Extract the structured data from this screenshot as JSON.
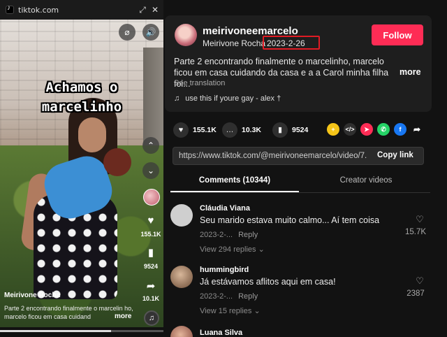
{
  "window": {
    "site": "tiktok.com"
  },
  "video": {
    "caption_line1": "Achamos o",
    "caption_line2": "marcelinho",
    "author": "Meirivone Rocha",
    "description": "Parte 2 encontrando finalmente o marcelin ho, marcelo ficou em casa cuidand",
    "more_label": "more",
    "likes": "155.1K",
    "saves": "9524",
    "shares": "10.1K",
    "progress": 0.68
  },
  "post": {
    "username": "meirivoneemarcelo",
    "nickname": "Meirivone Rocha",
    "separator": "·",
    "date": "2023-2-26",
    "follow_label": "Follow",
    "description": "Parte 2 encontrando finalmente o marcelinho, marcelo ficou em casa cuidando da casa e a a Carol minha filha foi...",
    "more_label": "more",
    "see_translation": "See translation",
    "music": "use this if youre gay - alex †"
  },
  "stats": {
    "likes": "155.1K",
    "comments": "10.3K",
    "saves": "9524"
  },
  "share_icons": [
    "plus-circle-icon",
    "embed-icon",
    "send-icon",
    "whatsapp-icon",
    "facebook-icon",
    "share-arrow-icon"
  ],
  "link": {
    "url": "https://www.tiktok.com/@meirivoneemarcelo/video/7...",
    "copy_label": "Copy link"
  },
  "tabs": {
    "comments": "Comments (10344)",
    "creator": "Creator videos"
  },
  "comments": [
    {
      "name": "Cláudia Viana",
      "text": "Seu marido estava muito calmo... Aí tem coisa",
      "date": "2023-2-...",
      "reply": "Reply",
      "view_replies": "View 294 replies",
      "likes": "15.7K"
    },
    {
      "name": "hummingbird",
      "text": "Já estávamos aflitos aqui em casa!",
      "date": "2023-2-...",
      "reply": "Reply",
      "view_replies": "View 15 replies",
      "likes": "2387"
    },
    {
      "name": "Luana Silva"
    }
  ],
  "colors": {
    "accent": "#fe2c55",
    "highlight": "#e01b24",
    "background": "#121212",
    "card": "#1e1e1e"
  }
}
